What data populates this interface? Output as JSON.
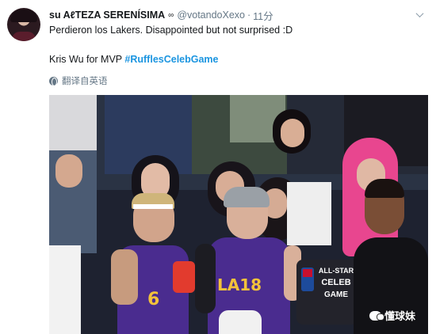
{
  "tweet": {
    "display_name": "su AℓTEZA SERENÍSIMA",
    "badge_icon": "chain-icon",
    "badge_glyph": "∞",
    "handle": "@votandoXexo",
    "separator": "·",
    "time": "11分",
    "text_line1": "Perdieron los Lakers. Disappointed but not surprised :D",
    "text_line2_plain": "Kris Wu for MVP ",
    "hashtag": "#RufflesCelebGame",
    "translate_label": "翻译自英语",
    "translate_icon": "globe-icon",
    "menu_icon": "chevron-down-icon"
  },
  "photo": {
    "jersey_left_number": "6",
    "jersey_right_text": "LA18",
    "sign_lines": [
      "ALL-STAR",
      "CELEB",
      "GAME"
    ],
    "watermark": "懂球妹"
  },
  "colors": {
    "link": "#1b95e0",
    "secondary_text": "#657786",
    "jersey_purple": "#4a2c8f",
    "jersey_gold": "#f3c23a",
    "pink_hair": "#e8468f",
    "arm_band": "#e23b2e"
  }
}
